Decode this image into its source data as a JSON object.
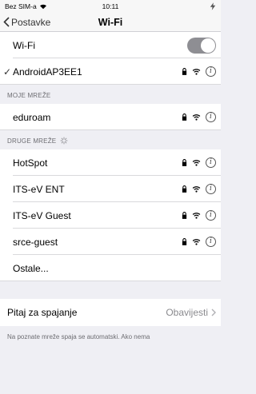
{
  "status_bar": {
    "carrier": "Bez SIM-a",
    "time": "10:11"
  },
  "nav": {
    "back_label": "Postavke",
    "title": "Wi-Fi"
  },
  "wifi_row": {
    "label": "Wi-Fi",
    "enabled": false
  },
  "connected": {
    "name": "AndroidAP3EE1"
  },
  "my_networks": {
    "header": "MOJE MREŽE",
    "items": [
      {
        "name": "eduroam"
      }
    ]
  },
  "other_networks": {
    "header": "DRUGE MREŽE",
    "items": [
      {
        "name": "HotSpot"
      },
      {
        "name": "ITS-eV ENT"
      },
      {
        "name": "ITS-eV Guest"
      },
      {
        "name": "srce-guest"
      }
    ],
    "other_label": "Ostale..."
  },
  "ask_to_join": {
    "label": "Pitaj za spajanje",
    "value": "Obavijesti"
  },
  "footer": {
    "text": "Na poznate mreže spaja se automatski. Ako nema"
  }
}
